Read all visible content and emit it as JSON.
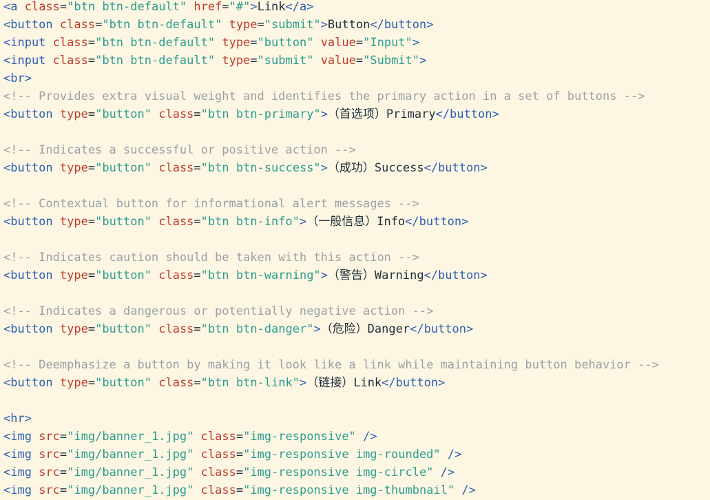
{
  "colors": {
    "background": "#fdf6e3",
    "tag": "#2b5fb3",
    "attribute": "#c0392b",
    "string": "#2a9d8f",
    "comment": "#9aa0a6",
    "text": "#1f2d3a"
  },
  "code_lines": [
    [
      {
        "t": "t",
        "v": "<a "
      },
      {
        "t": "a",
        "v": "class"
      },
      {
        "t": "x",
        "v": "="
      },
      {
        "t": "s",
        "v": "\"btn btn-default\""
      },
      {
        "t": "x",
        "v": " "
      },
      {
        "t": "a",
        "v": "href"
      },
      {
        "t": "x",
        "v": "="
      },
      {
        "t": "s",
        "v": "\"#\""
      },
      {
        "t": "t",
        "v": ">"
      },
      {
        "t": "x",
        "v": "Link"
      },
      {
        "t": "t",
        "v": "</a>"
      }
    ],
    [
      {
        "t": "t",
        "v": "<button "
      },
      {
        "t": "a",
        "v": "class"
      },
      {
        "t": "x",
        "v": "="
      },
      {
        "t": "s",
        "v": "\"btn btn-default\""
      },
      {
        "t": "x",
        "v": " "
      },
      {
        "t": "a",
        "v": "type"
      },
      {
        "t": "x",
        "v": "="
      },
      {
        "t": "s",
        "v": "\"submit\""
      },
      {
        "t": "t",
        "v": ">"
      },
      {
        "t": "x",
        "v": "Button"
      },
      {
        "t": "t",
        "v": "</button>"
      }
    ],
    [
      {
        "t": "t",
        "v": "<input "
      },
      {
        "t": "a",
        "v": "class"
      },
      {
        "t": "x",
        "v": "="
      },
      {
        "t": "s",
        "v": "\"btn btn-default\""
      },
      {
        "t": "x",
        "v": " "
      },
      {
        "t": "a",
        "v": "type"
      },
      {
        "t": "x",
        "v": "="
      },
      {
        "t": "s",
        "v": "\"button\""
      },
      {
        "t": "x",
        "v": " "
      },
      {
        "t": "a",
        "v": "value"
      },
      {
        "t": "x",
        "v": "="
      },
      {
        "t": "s",
        "v": "\"Input\""
      },
      {
        "t": "t",
        "v": ">"
      }
    ],
    [
      {
        "t": "t",
        "v": "<input "
      },
      {
        "t": "a",
        "v": "class"
      },
      {
        "t": "x",
        "v": "="
      },
      {
        "t": "s",
        "v": "\"btn btn-default\""
      },
      {
        "t": "x",
        "v": " "
      },
      {
        "t": "a",
        "v": "type"
      },
      {
        "t": "x",
        "v": "="
      },
      {
        "t": "s",
        "v": "\"submit\""
      },
      {
        "t": "x",
        "v": " "
      },
      {
        "t": "a",
        "v": "value"
      },
      {
        "t": "x",
        "v": "="
      },
      {
        "t": "s",
        "v": "\"Submit\""
      },
      {
        "t": "t",
        "v": ">"
      }
    ],
    [
      {
        "t": "t",
        "v": "<br>"
      }
    ],
    [
      {
        "t": "c",
        "v": "<!-- Provides extra visual weight and identifies the primary action in a set of buttons -->"
      }
    ],
    [
      {
        "t": "t",
        "v": "<button "
      },
      {
        "t": "a",
        "v": "type"
      },
      {
        "t": "x",
        "v": "="
      },
      {
        "t": "s",
        "v": "\"button\""
      },
      {
        "t": "x",
        "v": " "
      },
      {
        "t": "a",
        "v": "class"
      },
      {
        "t": "x",
        "v": "="
      },
      {
        "t": "s",
        "v": "\"btn btn-primary\""
      },
      {
        "t": "t",
        "v": ">"
      },
      {
        "t": "x",
        "v": "（首选项）Primary"
      },
      {
        "t": "t",
        "v": "</button>"
      }
    ],
    [],
    [
      {
        "t": "c",
        "v": "<!-- Indicates a successful or positive action -->"
      }
    ],
    [
      {
        "t": "t",
        "v": "<button "
      },
      {
        "t": "a",
        "v": "type"
      },
      {
        "t": "x",
        "v": "="
      },
      {
        "t": "s",
        "v": "\"button\""
      },
      {
        "t": "x",
        "v": " "
      },
      {
        "t": "a",
        "v": "class"
      },
      {
        "t": "x",
        "v": "="
      },
      {
        "t": "s",
        "v": "\"btn btn-success\""
      },
      {
        "t": "t",
        "v": ">"
      },
      {
        "t": "x",
        "v": "（成功）Success"
      },
      {
        "t": "t",
        "v": "</button>"
      }
    ],
    [],
    [
      {
        "t": "c",
        "v": "<!-- Contextual button for informational alert messages -->"
      }
    ],
    [
      {
        "t": "t",
        "v": "<button "
      },
      {
        "t": "a",
        "v": "type"
      },
      {
        "t": "x",
        "v": "="
      },
      {
        "t": "s",
        "v": "\"button\""
      },
      {
        "t": "x",
        "v": " "
      },
      {
        "t": "a",
        "v": "class"
      },
      {
        "t": "x",
        "v": "="
      },
      {
        "t": "s",
        "v": "\"btn btn-info\""
      },
      {
        "t": "t",
        "v": ">"
      },
      {
        "t": "x",
        "v": "（一般信息）Info"
      },
      {
        "t": "t",
        "v": "</button>"
      }
    ],
    [],
    [
      {
        "t": "c",
        "v": "<!-- Indicates caution should be taken with this action -->"
      }
    ],
    [
      {
        "t": "t",
        "v": "<button "
      },
      {
        "t": "a",
        "v": "type"
      },
      {
        "t": "x",
        "v": "="
      },
      {
        "t": "s",
        "v": "\"button\""
      },
      {
        "t": "x",
        "v": " "
      },
      {
        "t": "a",
        "v": "class"
      },
      {
        "t": "x",
        "v": "="
      },
      {
        "t": "s",
        "v": "\"btn btn-warning\""
      },
      {
        "t": "t",
        "v": ">"
      },
      {
        "t": "x",
        "v": "（警告）Warning"
      },
      {
        "t": "t",
        "v": "</button>"
      }
    ],
    [],
    [
      {
        "t": "c",
        "v": "<!-- Indicates a dangerous or potentially negative action -->"
      }
    ],
    [
      {
        "t": "t",
        "v": "<button "
      },
      {
        "t": "a",
        "v": "type"
      },
      {
        "t": "x",
        "v": "="
      },
      {
        "t": "s",
        "v": "\"button\""
      },
      {
        "t": "x",
        "v": " "
      },
      {
        "t": "a",
        "v": "class"
      },
      {
        "t": "x",
        "v": "="
      },
      {
        "t": "s",
        "v": "\"btn btn-danger\""
      },
      {
        "t": "t",
        "v": ">"
      },
      {
        "t": "x",
        "v": "（危险）Danger"
      },
      {
        "t": "t",
        "v": "</button>"
      }
    ],
    [],
    [
      {
        "t": "c",
        "v": "<!-- Deemphasize a button by making it look like a link while maintaining button behavior -->"
      }
    ],
    [
      {
        "t": "t",
        "v": "<button "
      },
      {
        "t": "a",
        "v": "type"
      },
      {
        "t": "x",
        "v": "="
      },
      {
        "t": "s",
        "v": "\"button\""
      },
      {
        "t": "x",
        "v": " "
      },
      {
        "t": "a",
        "v": "class"
      },
      {
        "t": "x",
        "v": "="
      },
      {
        "t": "s",
        "v": "\"btn btn-link\""
      },
      {
        "t": "t",
        "v": ">"
      },
      {
        "t": "x",
        "v": "（链接）Link"
      },
      {
        "t": "t",
        "v": "</button>"
      }
    ],
    [],
    [
      {
        "t": "t",
        "v": "<hr>"
      }
    ],
    [
      {
        "t": "t",
        "v": "<img "
      },
      {
        "t": "a",
        "v": "src"
      },
      {
        "t": "x",
        "v": "="
      },
      {
        "t": "s",
        "v": "\"img/banner_1.jpg\""
      },
      {
        "t": "x",
        "v": " "
      },
      {
        "t": "a",
        "v": "class"
      },
      {
        "t": "x",
        "v": "="
      },
      {
        "t": "s",
        "v": "\"img-responsive\""
      },
      {
        "t": "x",
        "v": " "
      },
      {
        "t": "t",
        "v": "/>"
      }
    ],
    [
      {
        "t": "t",
        "v": "<img "
      },
      {
        "t": "a",
        "v": "src"
      },
      {
        "t": "x",
        "v": "="
      },
      {
        "t": "s",
        "v": "\"img/banner_1.jpg\""
      },
      {
        "t": "x",
        "v": " "
      },
      {
        "t": "a",
        "v": "class"
      },
      {
        "t": "x",
        "v": "="
      },
      {
        "t": "s",
        "v": "\"img-responsive img-rounded\""
      },
      {
        "t": "x",
        "v": " "
      },
      {
        "t": "t",
        "v": "/>"
      }
    ],
    [
      {
        "t": "t",
        "v": "<img "
      },
      {
        "t": "a",
        "v": "src"
      },
      {
        "t": "x",
        "v": "="
      },
      {
        "t": "s",
        "v": "\"img/banner_1.jpg\""
      },
      {
        "t": "x",
        "v": " "
      },
      {
        "t": "a",
        "v": "class"
      },
      {
        "t": "x",
        "v": "="
      },
      {
        "t": "s",
        "v": "\"img-responsive img-circle\""
      },
      {
        "t": "x",
        "v": " "
      },
      {
        "t": "t",
        "v": "/>"
      }
    ],
    [
      {
        "t": "t",
        "v": "<img "
      },
      {
        "t": "a",
        "v": "src"
      },
      {
        "t": "x",
        "v": "="
      },
      {
        "t": "s",
        "v": "\"img/banner_1.jpg\""
      },
      {
        "t": "x",
        "v": " "
      },
      {
        "t": "a",
        "v": "class"
      },
      {
        "t": "x",
        "v": "="
      },
      {
        "t": "s",
        "v": "\"img-responsive img-thumbnail\""
      },
      {
        "t": "x",
        "v": " "
      },
      {
        "t": "t",
        "v": "/>"
      }
    ]
  ]
}
